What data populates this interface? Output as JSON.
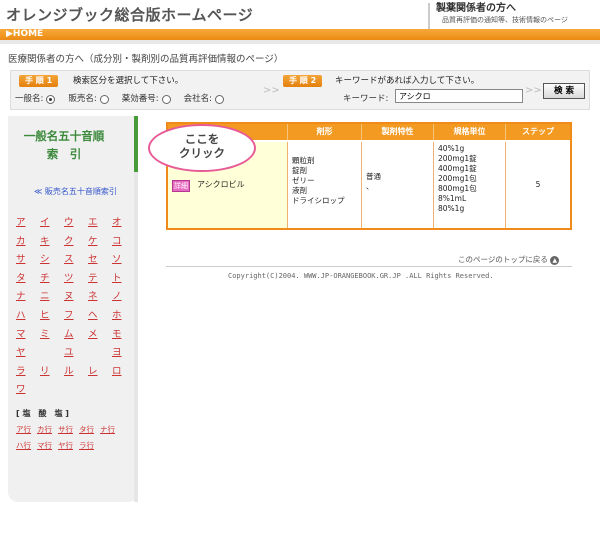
{
  "header": {
    "site_title": "オレンジブック総合版ホームページ",
    "right_title": "製薬関係者の方へ",
    "right_subtitle": "品質再評価の通知等、技術情報のページ"
  },
  "nav": {
    "home": "▶HOME"
  },
  "page_subtitle": "医療関係者の方へ（成分別・製剤別の品質再評価情報のページ）",
  "search": {
    "step1_label": "手 順 1",
    "step1_text": "検索区分を選択して下さい。",
    "step2_label": "手 順 2",
    "step2_text": "キーワードがあれば入力して下さい。",
    "radios": [
      {
        "label": "一般名:",
        "checked": true
      },
      {
        "label": "販売名:",
        "checked": false
      },
      {
        "label": "薬効番号:",
        "checked": false
      },
      {
        "label": "会社名:",
        "checked": false
      }
    ],
    "keyword_label": "キーワード:",
    "keyword_value": "アシクロ",
    "search_button": "検 索"
  },
  "sidebar": {
    "title_line1": "一般名五十音順",
    "title_line2": "索　引",
    "link": "≪ 販売名五十音順索引",
    "kana_rows": [
      [
        "ア",
        "イ",
        "ウ",
        "エ",
        "オ"
      ],
      [
        "カ",
        "キ",
        "ク",
        "ケ",
        "コ"
      ],
      [
        "サ",
        "シ",
        "ス",
        "セ",
        "ソ"
      ],
      [
        "タ",
        "チ",
        "ツ",
        "テ",
        "ト"
      ],
      [
        "ナ",
        "ニ",
        "ヌ",
        "ネ",
        "ノ"
      ],
      [
        "ハ",
        "ヒ",
        "フ",
        "ヘ",
        "ホ"
      ],
      [
        "マ",
        "ミ",
        "ム",
        "メ",
        "モ"
      ],
      [
        "ヤ",
        "",
        "ユ",
        "",
        "ヨ"
      ],
      [
        "ラ",
        "リ",
        "ル",
        "レ",
        "ロ"
      ],
      [
        "ワ",
        "",
        "",
        "",
        ""
      ]
    ],
    "acid_title": "[ 塩　酸　塩 ]",
    "acid_row1": [
      "ア行",
      "カ行",
      "サ行",
      "タ行",
      "ナ行"
    ],
    "acid_row2": [
      "ハ行",
      "マ行",
      "ヤ行",
      "ラ行"
    ]
  },
  "results": {
    "headers": [
      "",
      "剤形",
      "製剤特性",
      "規格単位",
      "ステップ"
    ],
    "rows": [
      {
        "detail_button": "詳細",
        "name": "アシクロビル",
        "forms": [
          "顆粒剤",
          "錠剤",
          "ゼリー",
          "液剤",
          "ドライシロップ"
        ],
        "property": "普通",
        "property_note": "、",
        "units": [
          "40%1g",
          "200mg1錠",
          "400mg1錠",
          "200mg1包",
          "800mg1包",
          "8%1mL",
          "80%1g"
        ],
        "step": "5"
      }
    ]
  },
  "callout": {
    "line1": "ここを",
    "line2": "クリック"
  },
  "back_to_top": "このページのトップに戻る",
  "copyright": "Copyright(C)2004. WWW.JP-ORANGEBOOK.GR.JP .ALL Rights Reserved."
}
